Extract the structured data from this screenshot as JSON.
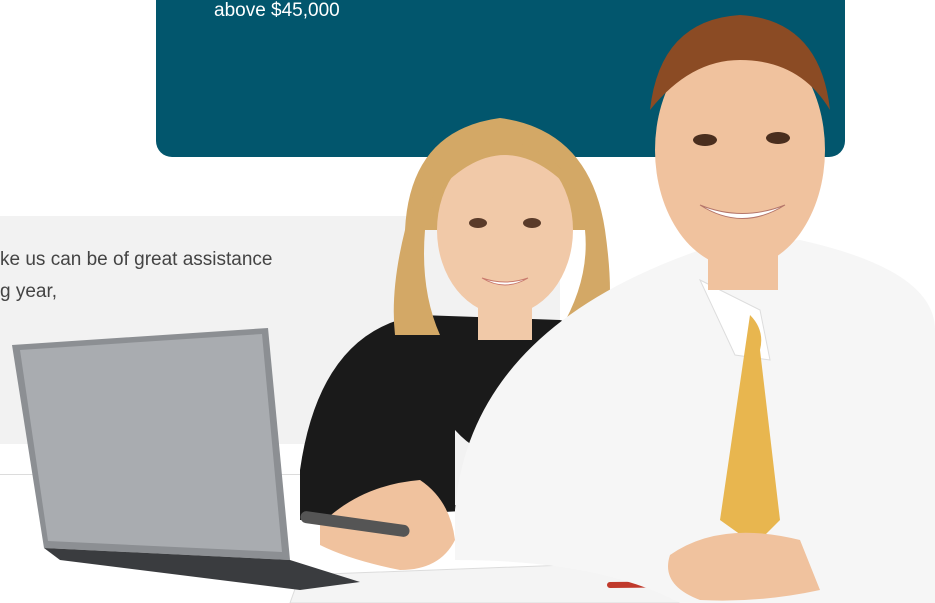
{
  "info_card": {
    "text": "above $45,000"
  },
  "intro": {
    "line1": "ke us can be of great assistance",
    "line2": "g year,"
  },
  "photo": {
    "subject": "two smiling office workers at a laptop"
  },
  "colors": {
    "card": "#02566d",
    "band": "#f2f2f2",
    "text": "#444444",
    "tie": "#e8b64f"
  }
}
